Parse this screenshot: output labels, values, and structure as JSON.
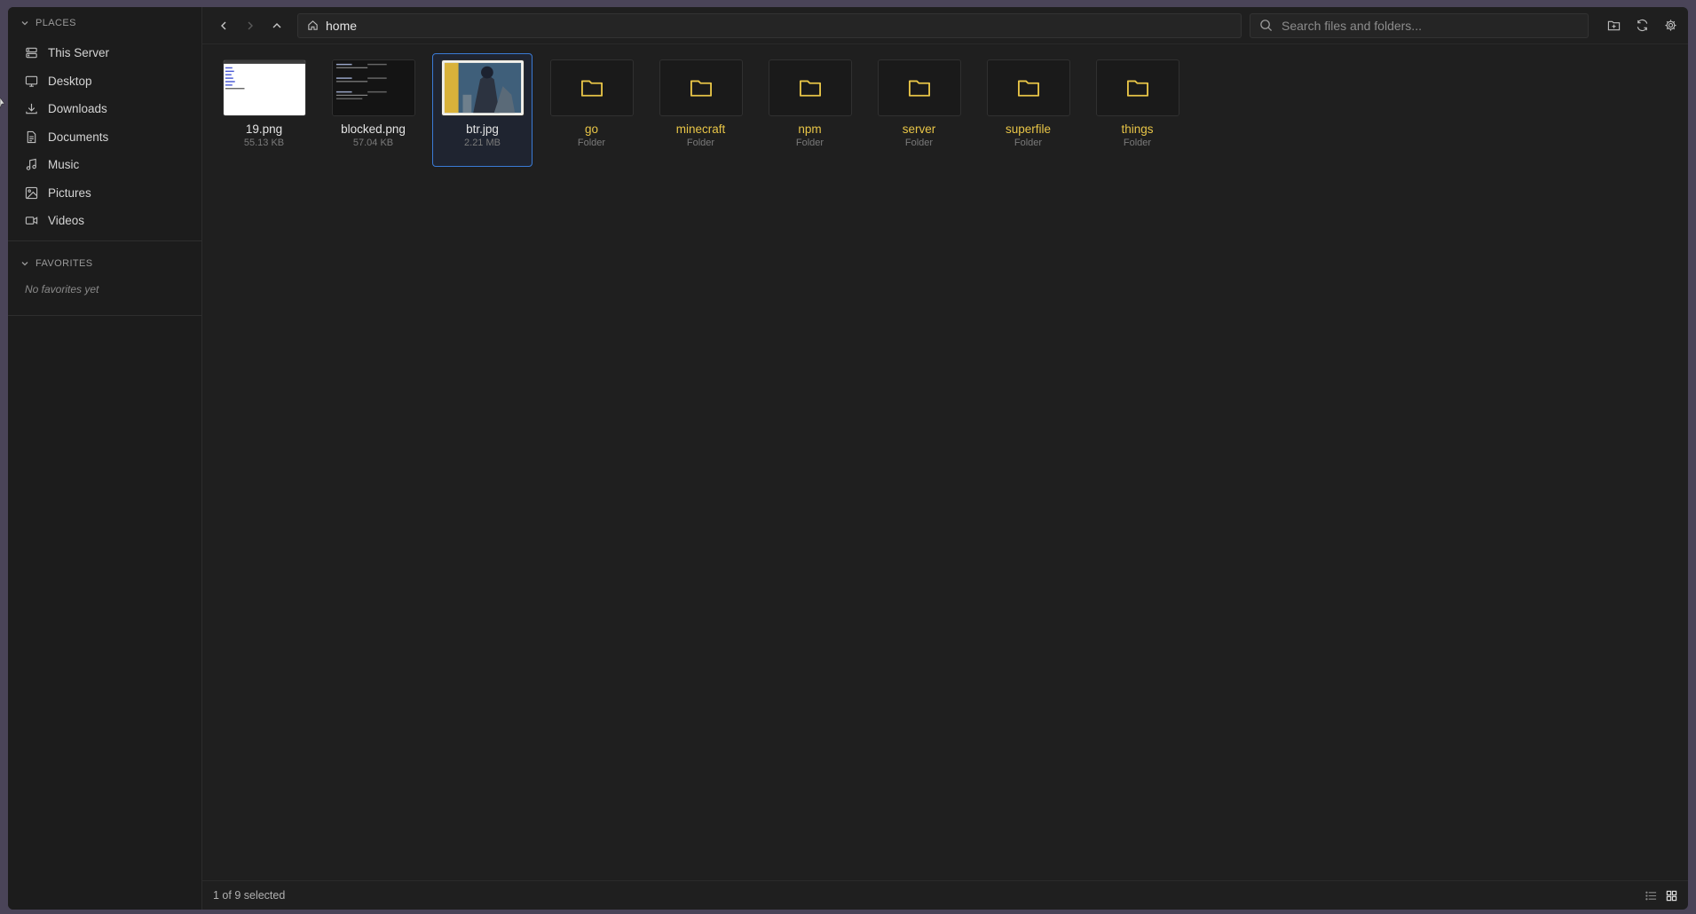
{
  "colors": {
    "folder": "#e8c547",
    "accent": "#3a7bd5",
    "background": "#1f1f1f"
  },
  "sidebar": {
    "places_header": "PLACES",
    "items": [
      {
        "label": "This Server",
        "icon": "server-icon"
      },
      {
        "label": "Desktop",
        "icon": "monitor-icon"
      },
      {
        "label": "Downloads",
        "icon": "download-icon"
      },
      {
        "label": "Documents",
        "icon": "document-icon"
      },
      {
        "label": "Music",
        "icon": "music-icon"
      },
      {
        "label": "Pictures",
        "icon": "image-icon"
      },
      {
        "label": "Videos",
        "icon": "video-icon"
      }
    ],
    "favorites_header": "FAVORITES",
    "favorites_empty": "No favorites yet"
  },
  "toolbar": {
    "path": "home",
    "search_placeholder": "Search files and folders..."
  },
  "files": [
    {
      "name": "19.png",
      "meta": "55.13 KB",
      "type": "image",
      "selected": false
    },
    {
      "name": "blocked.png",
      "meta": "57.04 KB",
      "type": "image",
      "selected": false
    },
    {
      "name": "btr.jpg",
      "meta": "2.21 MB",
      "type": "image",
      "selected": true
    },
    {
      "name": "go",
      "meta": "Folder",
      "type": "folder",
      "selected": false
    },
    {
      "name": "minecraft",
      "meta": "Folder",
      "type": "folder",
      "selected": false
    },
    {
      "name": "npm",
      "meta": "Folder",
      "type": "folder",
      "selected": false
    },
    {
      "name": "server",
      "meta": "Folder",
      "type": "folder",
      "selected": false
    },
    {
      "name": "superfile",
      "meta": "Folder",
      "type": "folder",
      "selected": false
    },
    {
      "name": "things",
      "meta": "Folder",
      "type": "folder",
      "selected": false
    }
  ],
  "status": {
    "selection": "1 of 9 selected"
  }
}
